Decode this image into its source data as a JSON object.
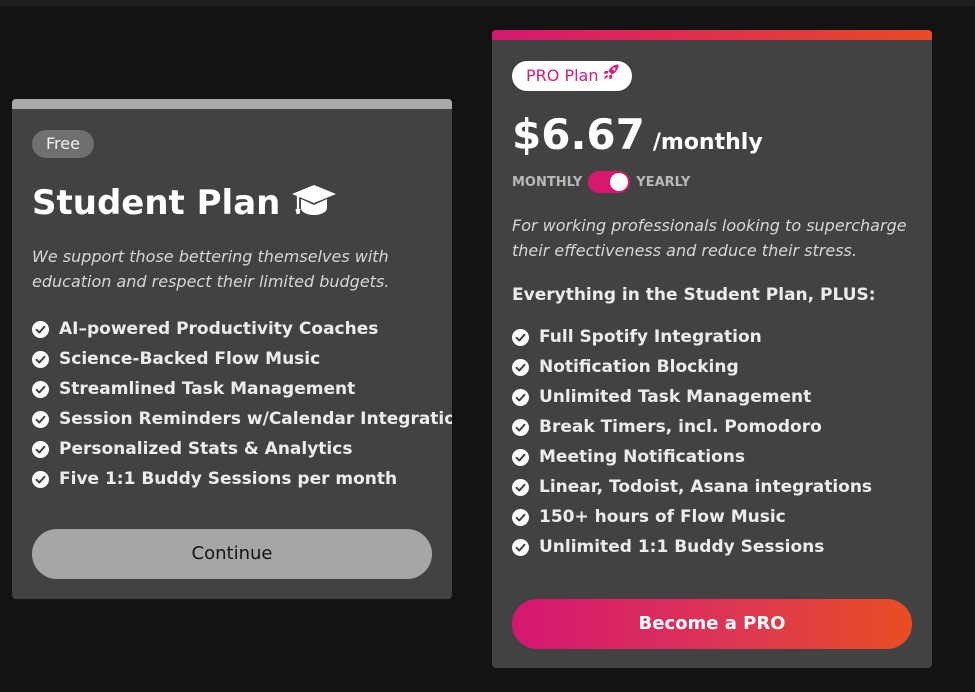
{
  "colors": {
    "background": "#131313",
    "card": "#424242",
    "free_accent": "#a9a9a9",
    "pro_gradient_start": "#d61870",
    "pro_gradient_end": "#e84a24",
    "badge_pro_text": "#d81b73"
  },
  "free_plan": {
    "badge": "Free",
    "title": "Student Plan",
    "title_icon": "graduation-cap-icon",
    "description": "We support those bettering themselves with education and respect their limited budgets.",
    "features": [
      "AI–powered Productivity Coaches",
      "Science-Backed Flow Music",
      "Streamlined Task Management",
      "Session Reminders w/Calendar Integration",
      "Personalized Stats & Analytics",
      "Five 1:1 Buddy Sessions per month"
    ],
    "button_label": "Continue"
  },
  "pro_plan": {
    "badge": "PRO Plan",
    "badge_icon": "rocket-icon",
    "price": "$6.67",
    "period": "/monthly",
    "toggle": {
      "left_label": "MONTHLY",
      "right_label": "YEARLY",
      "selected": "YEARLY"
    },
    "description": "For working professionals looking to supercharge their effectiveness and reduce their stress.",
    "features_heading": "Everything in the Student Plan, PLUS:",
    "features": [
      "Full Spotify Integration",
      "Notification Blocking",
      "Unlimited Task Management",
      "Break Timers, incl. Pomodoro",
      "Meeting Notifications",
      "Linear, Todoist, Asana integrations",
      "150+ hours of Flow Music",
      "Unlimited 1:1 Buddy Sessions"
    ],
    "button_label": "Become a PRO"
  }
}
